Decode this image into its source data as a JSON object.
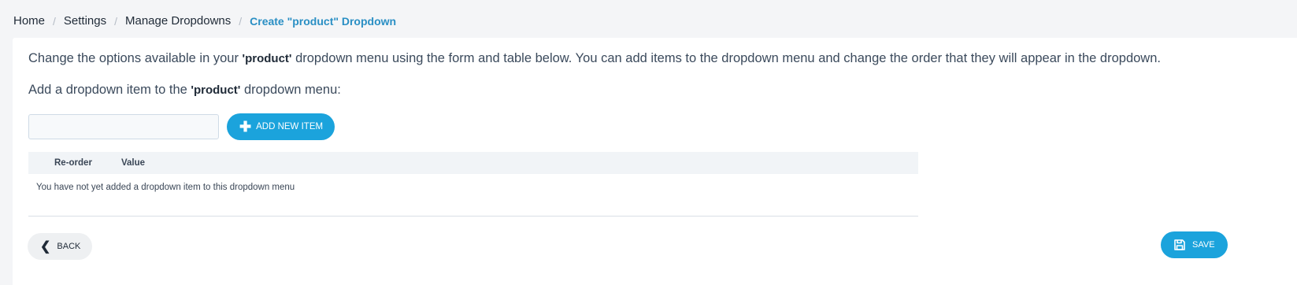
{
  "breadcrumb": {
    "items": [
      "Home",
      "Settings",
      "Manage Dropdowns"
    ],
    "current": "Create \"product\" Dropdown",
    "separator": "/"
  },
  "intro": {
    "text_before": "Change the options available in your ",
    "dropdown_name": "'product'",
    "text_after": " dropdown menu using the form and table below. You can add items to the dropdown menu and change the order that they will appear in the dropdown."
  },
  "subhead": {
    "text_before": "Add a dropdown item to the ",
    "dropdown_name": "'product'",
    "text_after": " dropdown menu:"
  },
  "form": {
    "input_value": "",
    "add_button_label": "ADD NEW ITEM",
    "add_button_icon": "plus-icon"
  },
  "table": {
    "columns": [
      "Re-order",
      "Value"
    ],
    "empty_message": "You have not yet added a dropdown item to this dropdown menu"
  },
  "footer": {
    "back_label": "BACK",
    "back_icon": "chevron-left-icon",
    "save_label": "SAVE",
    "save_icon": "floppy-disk-icon"
  },
  "colors": {
    "accent": "#1ba3dc",
    "breadcrumb_current": "#2a8fc4",
    "background": "#f4f5f7"
  }
}
